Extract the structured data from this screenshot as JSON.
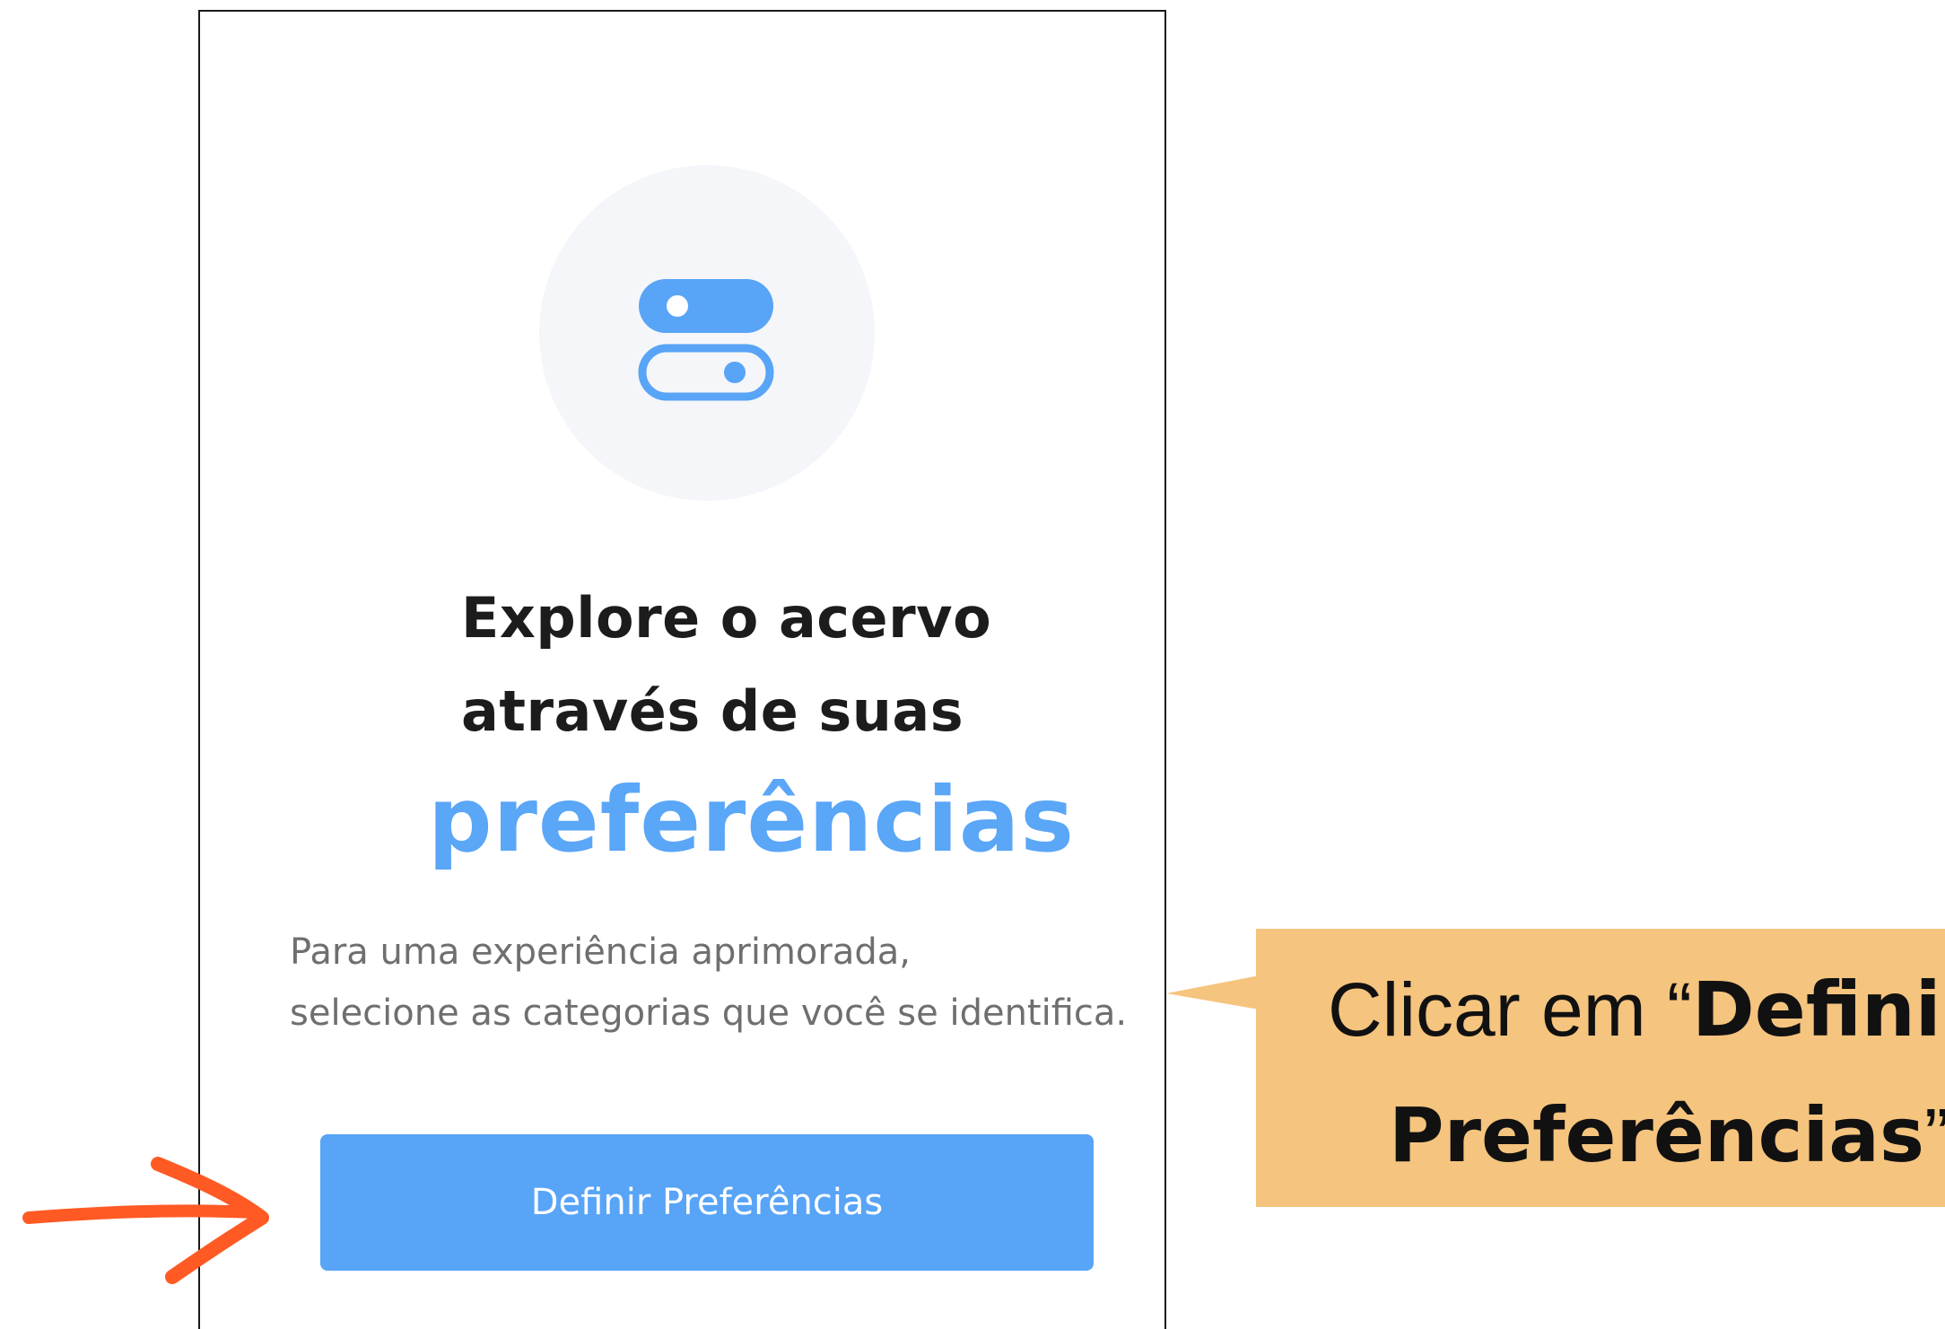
{
  "panel": {
    "icon": "toggle-switches-icon",
    "title_line1": "Explore o acervo",
    "title_line2": "através de suas",
    "title_highlight": "preferências",
    "description_line1": "Para uma experiência aprimorada,",
    "description_line2": "selecione as categorias que você se identifica.",
    "cta_label": "Definir Preferências"
  },
  "annotation": {
    "arrow_icon": "pointer-arrow-icon",
    "callout_prefix": "Clicar em “",
    "callout_bold_1": "Definir",
    "callout_bold_2": "Preferências",
    "callout_suffix": "”"
  },
  "colors": {
    "accent_blue": "#58a4f7",
    "callout_bg": "#f5c47e",
    "arrow_orange": "#ff5a24"
  }
}
